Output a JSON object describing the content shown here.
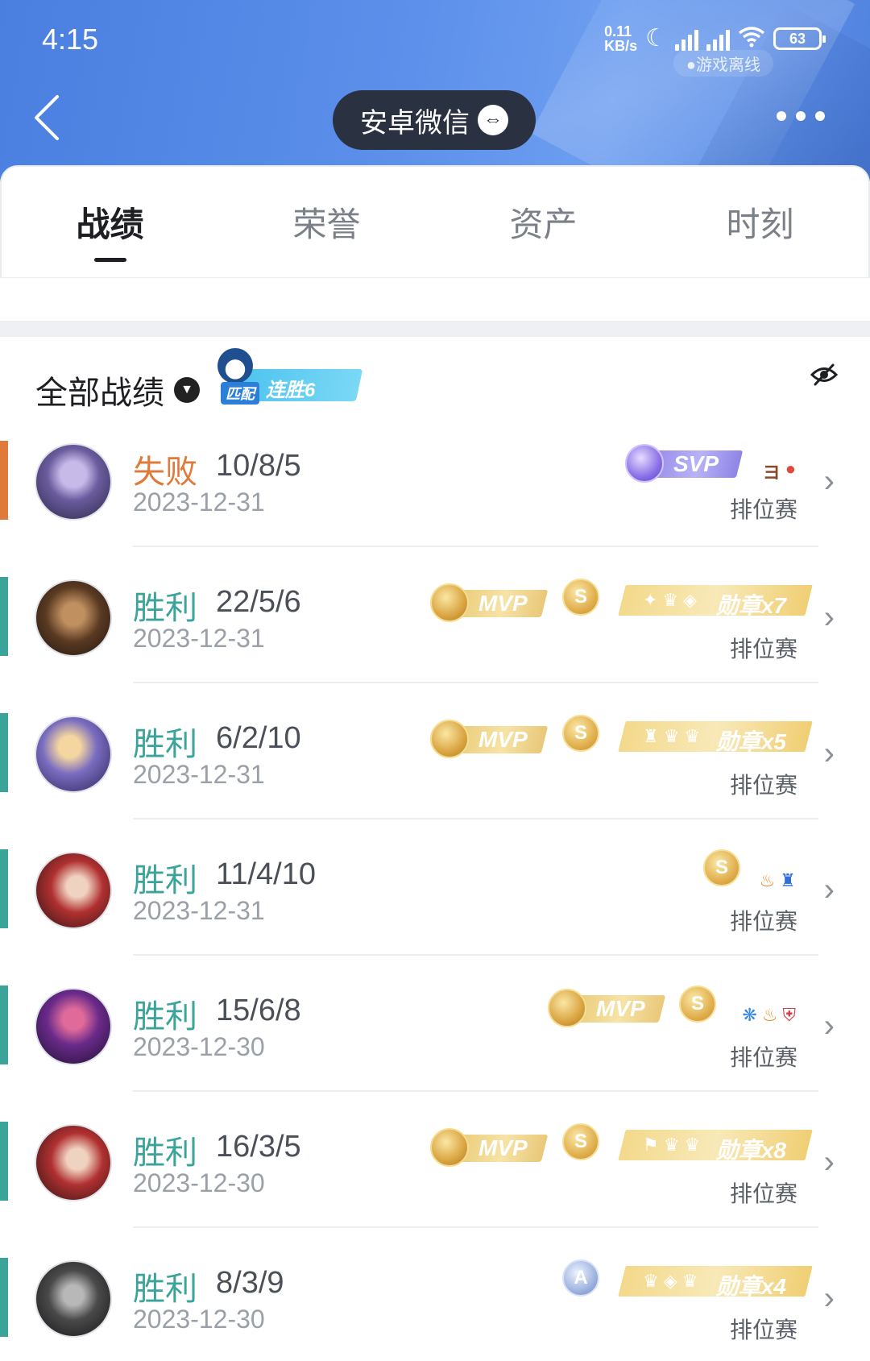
{
  "status_bar": {
    "time": "4:15",
    "net_speed_top": "0.11",
    "net_speed_bottom": "KB/s",
    "battery": "63",
    "offline_tag": "●游戏离线"
  },
  "header": {
    "title": "安卓微信",
    "swap_symbol": "⇔"
  },
  "tabs": [
    {
      "label": "战绩",
      "active": true
    },
    {
      "label": "荣誉",
      "active": false
    },
    {
      "label": "资产",
      "active": false
    },
    {
      "label": "时刻",
      "active": false
    }
  ],
  "section": {
    "title": "全部战绩",
    "streak_mode": "匹配",
    "streak_label": "连胜6"
  },
  "records": [
    {
      "result": "失败",
      "kda": "10/8/5",
      "date": "2023-12-31",
      "mode": "排位赛",
      "badge": "SVP",
      "medal": ""
    },
    {
      "result": "胜利",
      "kda": "22/5/6",
      "date": "2023-12-31",
      "mode": "排位赛",
      "badge": "MVP",
      "medal": "勋章x7"
    },
    {
      "result": "胜利",
      "kda": "6/2/10",
      "date": "2023-12-31",
      "mode": "排位赛",
      "badge": "MVP",
      "medal": "勋章x5"
    },
    {
      "result": "胜利",
      "kda": "11/4/10",
      "date": "2023-12-31",
      "mode": "排位赛",
      "badge": "",
      "medal": ""
    },
    {
      "result": "胜利",
      "kda": "15/6/8",
      "date": "2023-12-30",
      "mode": "排位赛",
      "badge": "MVP",
      "medal": ""
    },
    {
      "result": "胜利",
      "kda": "16/3/5",
      "date": "2023-12-30",
      "mode": "排位赛",
      "badge": "MVP",
      "medal": "勋章x8"
    },
    {
      "result": "胜利",
      "kda": "8/3/9",
      "date": "2023-12-30",
      "mode": "排位赛",
      "badge": "",
      "medal": "勋章x4"
    }
  ],
  "coin_labels": {
    "s": "S",
    "a": "A"
  },
  "colors": {
    "lose": "#e07a3a",
    "win": "#3aa39a",
    "header_blue": "#5b8fea"
  }
}
